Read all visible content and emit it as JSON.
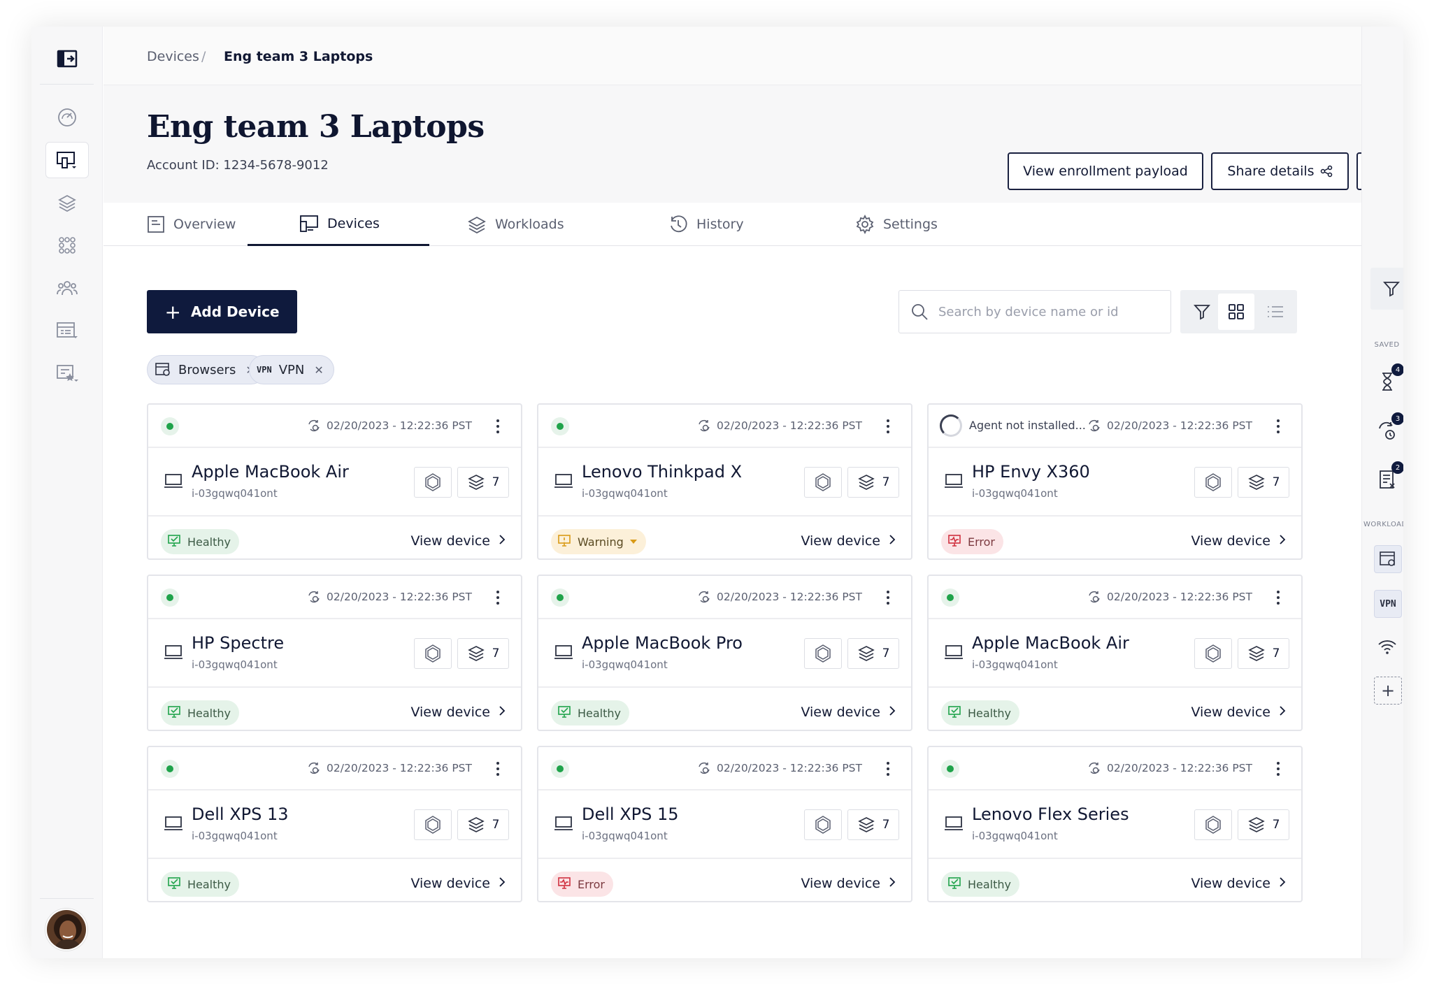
{
  "breadcrumb": {
    "root": "Devices",
    "separator": "/",
    "current": "Eng team 3 Laptops"
  },
  "header": {
    "title": "Eng team 3 Laptops",
    "account_label": "Account ID:",
    "account_id": "1234-5678-9012",
    "view_payload_label": "View enrollment payload",
    "share_label": "Share details"
  },
  "tabs": [
    {
      "label": "Overview",
      "icon": "overview-icon",
      "active": false
    },
    {
      "label": "Devices",
      "icon": "devices-icon",
      "active": true
    },
    {
      "label": "Workloads",
      "icon": "workloads-icon",
      "active": false
    },
    {
      "label": "History",
      "icon": "history-icon",
      "active": false
    },
    {
      "label": "Settings",
      "icon": "settings-icon",
      "active": false
    }
  ],
  "toolbar": {
    "add_label": "Add Device",
    "search_placeholder": "Search by device name or id"
  },
  "filters": [
    {
      "label": "Browsers",
      "icon": "browser-icon"
    },
    {
      "label": "VPN",
      "icon": "vpn-icon"
    }
  ],
  "devices": [
    {
      "name": "Apple MacBook Air",
      "id": "i-03gqwq041ont",
      "timestamp": "02/20/2023 - 12:22:36 PST",
      "workloads": "7",
      "status": "Healthy",
      "link": "View device",
      "agent": ""
    },
    {
      "name": "Lenovo Thinkpad X",
      "id": "i-03gqwq041ont",
      "timestamp": "02/20/2023 - 12:22:36 PST",
      "workloads": "7",
      "status": "Warning",
      "link": "View device",
      "agent": ""
    },
    {
      "name": "HP Envy X360",
      "id": "i-03gqwq041ont",
      "timestamp": "02/20/2023 - 12:22:36 PST",
      "workloads": "7",
      "status": "Error",
      "link": "View device",
      "agent": "Agent not installed..."
    },
    {
      "name": "HP Spectre",
      "id": "i-03gqwq041ont",
      "timestamp": "02/20/2023 - 12:22:36 PST",
      "workloads": "7",
      "status": "Healthy",
      "link": "View device",
      "agent": ""
    },
    {
      "name": "Apple MacBook Pro",
      "id": "i-03gqwq041ont",
      "timestamp": "02/20/2023 - 12:22:36 PST",
      "workloads": "7",
      "status": "Healthy",
      "link": "View device",
      "agent": ""
    },
    {
      "name": "Apple MacBook Air",
      "id": "i-03gqwq041ont",
      "timestamp": "02/20/2023 - 12:22:36 PST",
      "workloads": "7",
      "status": "Healthy",
      "link": "View device",
      "agent": ""
    },
    {
      "name": "Dell XPS 13",
      "id": "i-03gqwq041ont",
      "timestamp": "02/20/2023 - 12:22:36 PST",
      "workloads": "7",
      "status": "Healthy",
      "link": "View device",
      "agent": ""
    },
    {
      "name": "Dell XPS 15",
      "id": "i-03gqwq041ont",
      "timestamp": "02/20/2023 - 12:22:36 PST",
      "workloads": "7",
      "status": "Error",
      "link": "View device",
      "agent": ""
    },
    {
      "name": "Lenovo Flex Series",
      "id": "i-03gqwq041ont",
      "timestamp": "02/20/2023 - 12:22:36 PST",
      "workloads": "7",
      "status": "Healthy",
      "link": "View device",
      "agent": ""
    }
  ],
  "right_rail": {
    "saved_label": "SAVED",
    "workload_label": "WORKLOAD",
    "saved_counts": [
      "4",
      "3",
      "2"
    ],
    "vpn_label": "VPN"
  },
  "colors": {
    "primary": "#0f1a3d",
    "healthy": "#1fa34a",
    "warning": "#d99a16",
    "error": "#d0303f"
  }
}
